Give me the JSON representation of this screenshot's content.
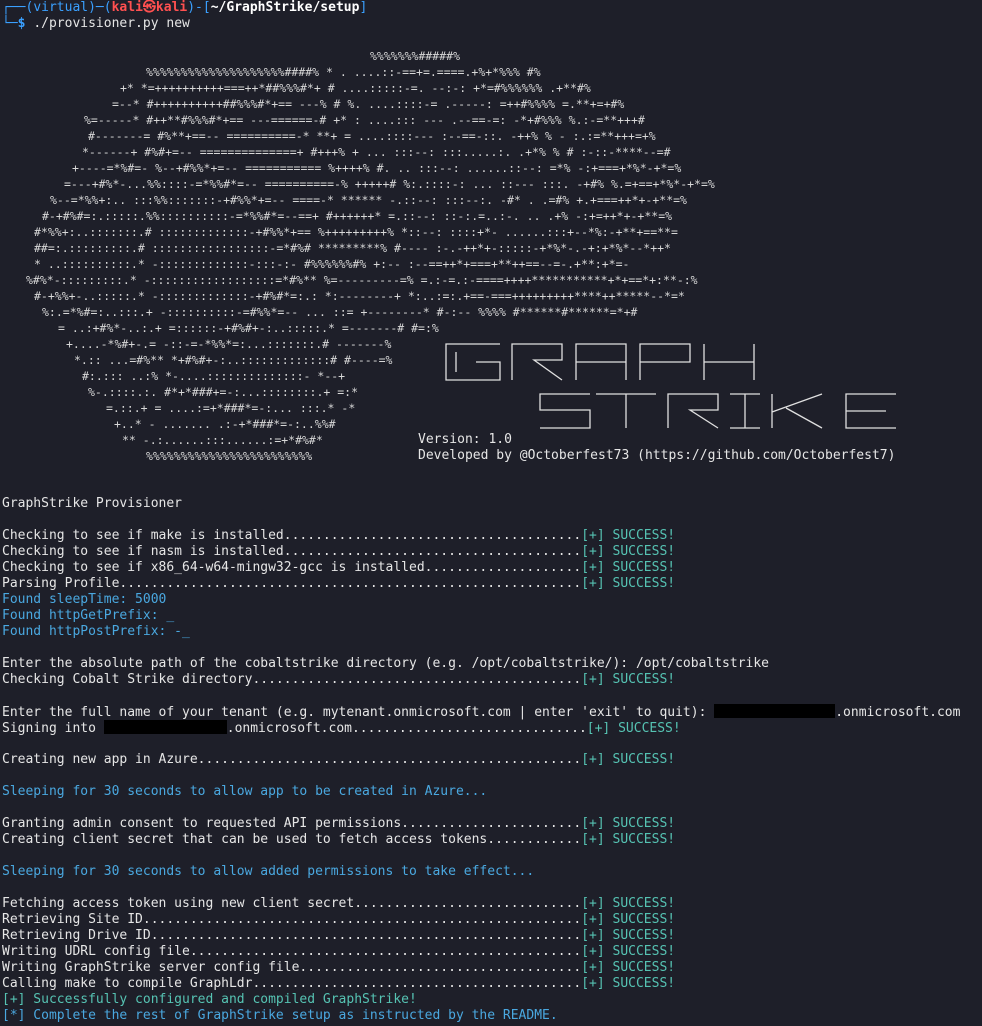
{
  "prompt": {
    "frame_open": "┌──(",
    "env": "virtual",
    "frame_mid": ")─(",
    "user": "kali",
    "at": "㉿",
    "host": "kali",
    "frame_path_open": ")-[",
    "path": "~/GraphStrike/setup",
    "frame_close": "]",
    "line2_prefix": "└─",
    "dollar": "$",
    "command": "./provisioner.py new"
  },
  "banner": {
    "version": "Version: 1.0",
    "developer": "Developed by @Octoberfest73 (https://github.com/Octoberfest7)"
  },
  "output": {
    "title": "GraphStrike Provisioner",
    "checks": [
      {
        "text": "Checking to see if make is installed......................................",
        "status": "[+] SUCCESS!"
      },
      {
        "text": "Checking to see if nasm is installed......................................",
        "status": "[+] SUCCESS!"
      },
      {
        "text": "Checking to see if x86_64-w64-mingw32-gcc is installed....................",
        "status": "[+] SUCCESS!"
      },
      {
        "text": "Parsing Profile...........................................................",
        "status": "[+] SUCCESS!"
      }
    ],
    "found": [
      "Found sleepTime: 5000",
      "Found httpGetPrefix: _",
      "Found httpPostPrefix: -_"
    ],
    "cs_prompt": "Enter the absolute path of the cobaltstrike directory (e.g. /opt/cobaltstrike/): /opt/cobaltstrike",
    "cs_check": {
      "text": "Checking Cobalt Strike directory..........................................",
      "status": "[+] SUCCESS!"
    },
    "tenant_prompt": "Enter the full name of your tenant (e.g. mytenant.onmicrosoft.com | enter 'exit' to quit): ",
    "tenant_suffix": ".onmicrosoft.com",
    "signing_prefix": "Signing into ",
    "signing_suffix": ".onmicrosoft.com..............................",
    "signing_status": "[+] SUCCESS!",
    "create_app": {
      "text": "Creating new app in Azure.................................................",
      "status": "[+] SUCCESS!"
    },
    "sleep1": "Sleeping for 30 seconds to allow app to be created in Azure...",
    "grant": {
      "text": "Granting admin consent to requested API permissions.......................",
      "status": "[+] SUCCESS!"
    },
    "secret": {
      "text": "Creating client secret that can be used to fetch access tokens............",
      "status": "[+] SUCCESS!"
    },
    "sleep2": "Sleeping for 30 seconds to allow added permissions to take effect...",
    "final_steps": [
      {
        "text": "Fetching access token using new client secret.............................",
        "status": "[+] SUCCESS!"
      },
      {
        "text": "Retrieving Site ID........................................................",
        "status": "[+] SUCCESS!"
      },
      {
        "text": "Retrieving Drive ID.......................................................",
        "status": "[+] SUCCESS!"
      },
      {
        "text": "Writing UDRL config file..................................................",
        "status": "[+] SUCCESS!"
      },
      {
        "text": "Writing GraphStrike server config file....................................",
        "status": "[+] SUCCESS!"
      },
      {
        "text": "Calling make to compile GraphLdr..........................................",
        "status": "[+] SUCCESS!"
      }
    ],
    "done1": "[+] Successfully configured and compiled GraphStrike!",
    "done2": "[*] Complete the rest of GraphStrike setup as instructed by the README."
  },
  "colors": {
    "background": "#1e1f29",
    "success": "#56c3b3",
    "info": "#4aa8e0",
    "prompt_blue": "#3aa0ff",
    "prompt_red": "#ff5050"
  }
}
